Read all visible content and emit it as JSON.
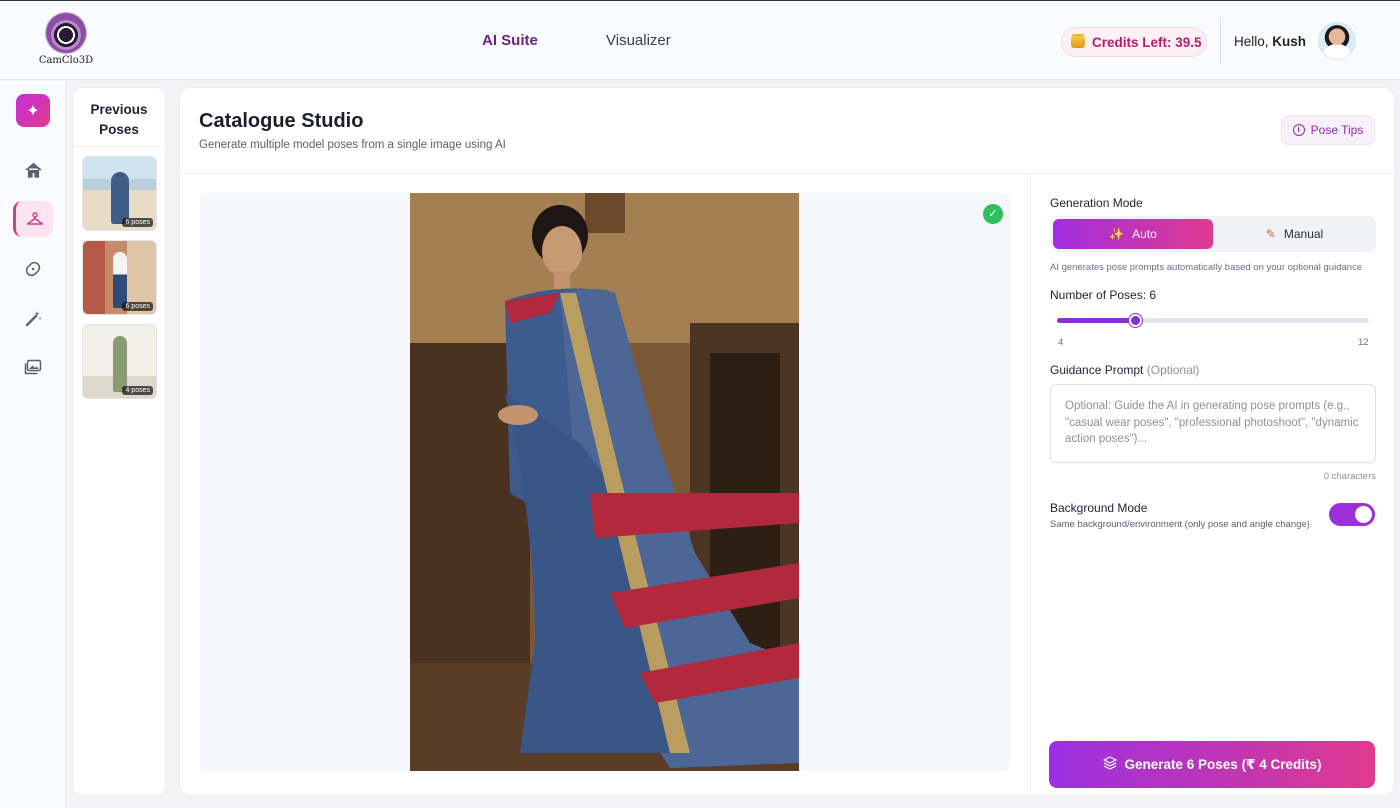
{
  "header": {
    "logo_text": "CamClo3D",
    "nav": [
      {
        "label": "AI Suite",
        "active": true
      },
      {
        "label": "Visualizer",
        "active": false
      }
    ],
    "credits_label": "Credits Left: 39.5",
    "greeting": "Hello, ",
    "user_name": "Kush"
  },
  "rail": {
    "items": [
      {
        "icon": "sparkle-icon",
        "glyph": "✦"
      },
      {
        "icon": "home-icon",
        "glyph": "⌂"
      },
      {
        "icon": "hanger-icon",
        "glyph": "⚲",
        "active": true
      },
      {
        "icon": "bandage-icon",
        "glyph": "⬭"
      },
      {
        "icon": "magic-wand-icon",
        "glyph": "⚘"
      },
      {
        "icon": "gallery-icon",
        "glyph": "▤"
      }
    ]
  },
  "previous_poses": {
    "title": "Previous Poses",
    "items": [
      {
        "badge": "6 poses"
      },
      {
        "badge": "6 poses"
      },
      {
        "badge": "4 poses"
      }
    ]
  },
  "main": {
    "title": "Catalogue Studio",
    "subtitle": "Generate multiple model poses from a single image using AI",
    "pose_tips_label": "Pose Tips",
    "check_glyph": "✓"
  },
  "settings": {
    "generation_mode_label": "Generation Mode",
    "mode_auto": "Auto",
    "mode_manual": "Manual",
    "mode_selected": "Auto",
    "mode_hint": "AI generates pose prompts automatically based on your optional guidance",
    "poses_label": "Number of Poses: 6",
    "poses_value": 6,
    "poses_min": 4,
    "poses_max": 12,
    "poses_min_label": "4",
    "poses_max_label": "12",
    "guidance_label": "Guidance Prompt",
    "guidance_optional": "(Optional)",
    "guidance_placeholder": "Optional: Guide the AI in generating pose prompts (e.g., \"casual wear poses\", \"professional photoshoot\", \"dynamic action poses\")...",
    "char_count": "0 characters",
    "background_mode_label": "Background Mode",
    "background_mode_desc": "Same background/environment (only pose and angle change)",
    "background_mode_on": true
  },
  "generate_button": "Generate 6 Poses  (₹ 4 Credits)",
  "colors": {
    "accent_purple": "#9a30e0",
    "accent_pink": "#e03a8f",
    "success_green": "#2fbf5b"
  }
}
